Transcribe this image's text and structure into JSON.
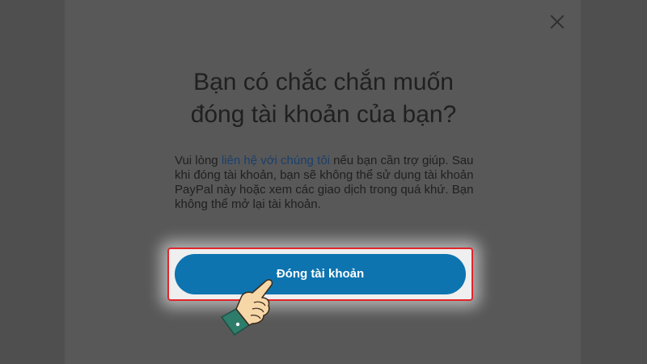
{
  "dialog": {
    "heading_line1": "Bạn có chắc chắn muốn",
    "heading_line2": "đóng tài khoản của bạn?",
    "body_prefix": "Vui lòng ",
    "body_link": "liên hệ với chúng tôi",
    "body_suffix": " nếu bạn cần trợ giúp. Sau khi đóng tài khoản, bạn sẽ không thể sử dụng tài khoản PayPal này hoặc xem các giao dịch trong quá khứ. Bạn không thể mở lại tài khoản.",
    "primary_button_label": "Đóng tài khoản",
    "close_icon": "close-icon"
  },
  "overlay": {
    "pointer_icon": "pointing-hand-icon"
  },
  "colors": {
    "button": "#0d74b0",
    "highlight_border": "#e1252a",
    "link": "#1a3f6b",
    "backdrop": "#4f4f4f"
  }
}
